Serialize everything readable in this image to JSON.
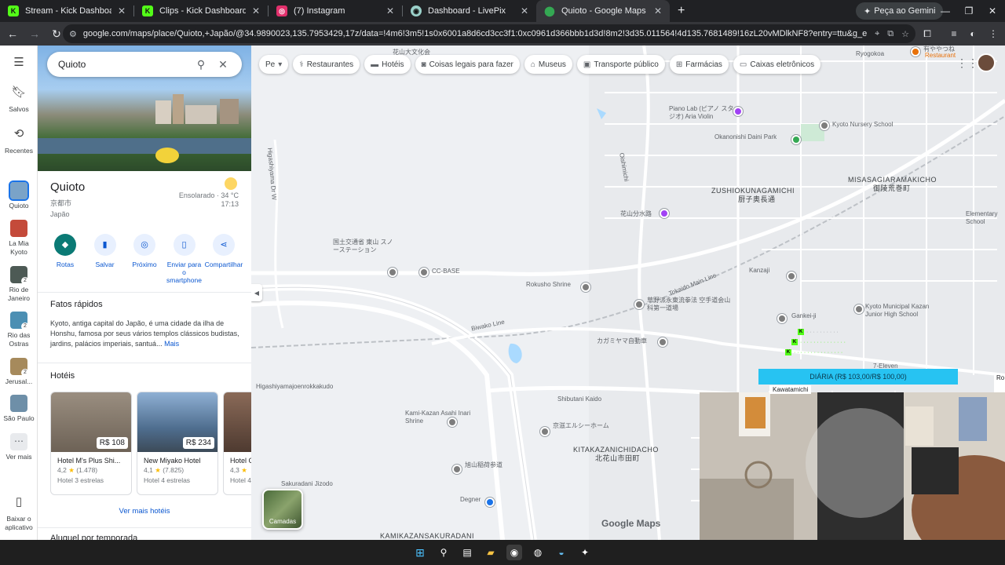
{
  "browser": {
    "tabs": [
      {
        "title": "Stream - Kick Dashboard",
        "favicon_color": "#53fc18",
        "favicon_text": "K"
      },
      {
        "title": "Clips - Kick Dashboard",
        "favicon_color": "#53fc18",
        "favicon_text": "K"
      },
      {
        "title": "(7) Instagram",
        "favicon_color": "#e1306c",
        "favicon_text": "◎"
      },
      {
        "title": "Dashboard - LivePix",
        "favicon_color": "#9ad0c9",
        "favicon_text": "◉"
      },
      {
        "title": "Quioto - Google Maps",
        "favicon_color": "#34a853",
        "favicon_text": "⬤"
      }
    ],
    "gemini_label": "Peça ao Gemini",
    "url": "google.com/maps/place/Quioto,+Japão/@34.9890023,135.7953429,17z/data=!4m6!3m5!1s0x6001a8d6cd3cc3f1:0xc0961d366bbb1d3d!8m2!3d35.011564!4d135.7681489!16zL20vMDlkNF8?entry=ttu&g_ep=EgoyMDI2MDgwMy4wIKXMDS..."
  },
  "rail": {
    "items": [
      {
        "label": "Salvos",
        "icon": "bookmark-icon"
      },
      {
        "label": "Recentes",
        "icon": "history-icon"
      },
      {
        "label": "Quioto",
        "thumb": "#7aa3c8"
      },
      {
        "label": "La Mia Kyoto",
        "thumb": "#c44a3a"
      },
      {
        "label": "Rio de Janeiro",
        "thumb": "#4d5a55",
        "count": "2"
      },
      {
        "label": "Rio das Ostras",
        "thumb": "#4c8fb3",
        "count": "2"
      },
      {
        "label": "Jerusal...",
        "thumb": "#a68a5c",
        "count": "2"
      },
      {
        "label": "São Paulo",
        "thumb": "#6e8fa8"
      },
      {
        "label": "Ver mais",
        "icon": "more-icon"
      },
      {
        "label": "Baixar o aplicativo",
        "icon": "phone-icon"
      }
    ]
  },
  "panel": {
    "search_value": "Quioto",
    "place_name": "Quioto",
    "native_name": "京都市",
    "country": "Japão",
    "weather_text": "Ensolarado · 34 °C",
    "weather_time": "17:13",
    "actions": [
      {
        "label": "Rotas",
        "icon": "directions-icon"
      },
      {
        "label": "Salvar",
        "icon": "bookmark-icon"
      },
      {
        "label": "Próximo",
        "icon": "nearby-icon"
      },
      {
        "label": "Enviar para o smartphone",
        "icon": "send-to-phone-icon"
      },
      {
        "label": "Compartilhar",
        "icon": "share-icon"
      }
    ],
    "facts_title": "Fatos rápidos",
    "facts_text": "Kyoto, antiga capital do Japão, é uma cidade da ilha de Honshu, famosa por seus vários templos clássicos budistas, jardins, palácios imperiais, santuá...",
    "facts_more": "Mais",
    "hotels_title": "Hotéis",
    "hotels": [
      {
        "name": "Hotel M's Plus Shi...",
        "price": "R$ 108",
        "rating": "4,2",
        "reviews": "(1.478)",
        "class": "Hotel 3 estrelas",
        "img": "#8a7d6e"
      },
      {
        "name": "New Miyako Hotel",
        "price": "R$ 234",
        "rating": "4,1",
        "reviews": "(7.825)",
        "class": "Hotel 4 estrelas",
        "img": "#5f7fa3"
      },
      {
        "name": "Hotel G...",
        "price": "",
        "rating": "4,3",
        "reviews": "",
        "class": "Hotel 4...",
        "img": "#7a5a4a"
      }
    ],
    "more_hotels": "Ver mais hotéis",
    "next_section": "Aluguel por temporada"
  },
  "map": {
    "chips": [
      {
        "label": "Pe",
        "icon": "dropdown-icon"
      },
      {
        "label": "Restaurantes",
        "icon": "restaurant-icon"
      },
      {
        "label": "Hotéis",
        "icon": "hotel-icon"
      },
      {
        "label": "Coisas legais para fazer",
        "icon": "camera-icon"
      },
      {
        "label": "Museus",
        "icon": "museum-icon"
      },
      {
        "label": "Transporte público",
        "icon": "transit-icon"
      },
      {
        "label": "Farmácias",
        "icon": "pharmacy-icon"
      },
      {
        "label": "Caixas eletrônicos",
        "icon": "atm-icon"
      }
    ],
    "labels": [
      {
        "text": "Ryogokoa",
        "cls": ""
      },
      {
        "text": "有ややつね",
        "cls": ""
      },
      {
        "text": "花山大文化会",
        "cls": ""
      },
      {
        "text": "Piano Lab (ピアノ スタジオ) Aria Violin",
        "cls": "poi"
      },
      {
        "text": "Kyoto Nursery School",
        "cls": "poi"
      },
      {
        "text": "Okanonishi Daini Park",
        "cls": "poi"
      },
      {
        "text": "ZUSHIOKUNAGAMICHI",
        "cls": "big"
      },
      {
        "text": "厨子奥長通",
        "cls": "big"
      },
      {
        "text": "MISASAGIARAMAKICHO",
        "cls": "big"
      },
      {
        "text": "御陵荒巻町",
        "cls": "big"
      },
      {
        "text": "花山分水路",
        "cls": "poi"
      },
      {
        "text": "Higashiyama Dr W",
        "cls": ""
      },
      {
        "text": "Oishimichi",
        "cls": ""
      },
      {
        "text": "国土交通省 東山 スノーステーション",
        "cls": "poi"
      },
      {
        "text": "CC-BASE",
        "cls": "poi"
      },
      {
        "text": "Rokusho Shrine",
        "cls": "poi"
      },
      {
        "text": "Kanzaji",
        "cls": "poi"
      },
      {
        "text": "Kyoto Municipal Kazan Junior High School",
        "cls": "poi"
      },
      {
        "text": "草野派永東流拳法 空手道会山科第一道場",
        "cls": "poi"
      },
      {
        "text": "Gankei-ji",
        "cls": "poi"
      },
      {
        "text": "カガミヤマ自動車",
        "cls": "poi"
      },
      {
        "text": "Biwako Line",
        "cls": ""
      },
      {
        "text": "Tokaido Main Line",
        "cls": ""
      },
      {
        "text": "Higashiyamajoenrokkakudo",
        "cls": ""
      },
      {
        "text": "Shibutani Kaido",
        "cls": ""
      },
      {
        "text": "Kami-Kazan Asahi Inari Shrine",
        "cls": "poi"
      },
      {
        "text": "京滋エルシーホーム",
        "cls": "poi"
      },
      {
        "text": "KITAKAZANICHIDACHO",
        "cls": "big"
      },
      {
        "text": "北花山市田町",
        "cls": "big"
      },
      {
        "text": "旭山稲荷参道",
        "cls": "poi"
      },
      {
        "text": "Sakuradani Jizodo",
        "cls": "poi"
      },
      {
        "text": "Degner",
        "cls": "poi"
      },
      {
        "text": "KAMIKAZANSAKURADANI",
        "cls": "big"
      },
      {
        "text": "Elementary School",
        "cls": "poi"
      },
      {
        "text": "Restaurant",
        "cls": "poi"
      },
      {
        "text": "7-Eleven",
        "cls": "poi"
      }
    ],
    "layers_label": "Camadas",
    "logo": "Google Maps",
    "overlay_bar": "DIÁRIA (R$ 103,00/R$ 100,00)",
    "cam_label": "Kawatamichi",
    "cam_label2": "Ro"
  },
  "taskbar": [
    "start-icon",
    "search-icon",
    "taskview-icon",
    "files-icon",
    "chrome-icon",
    "obs-icon",
    "steam-icon",
    "app-icon"
  ]
}
